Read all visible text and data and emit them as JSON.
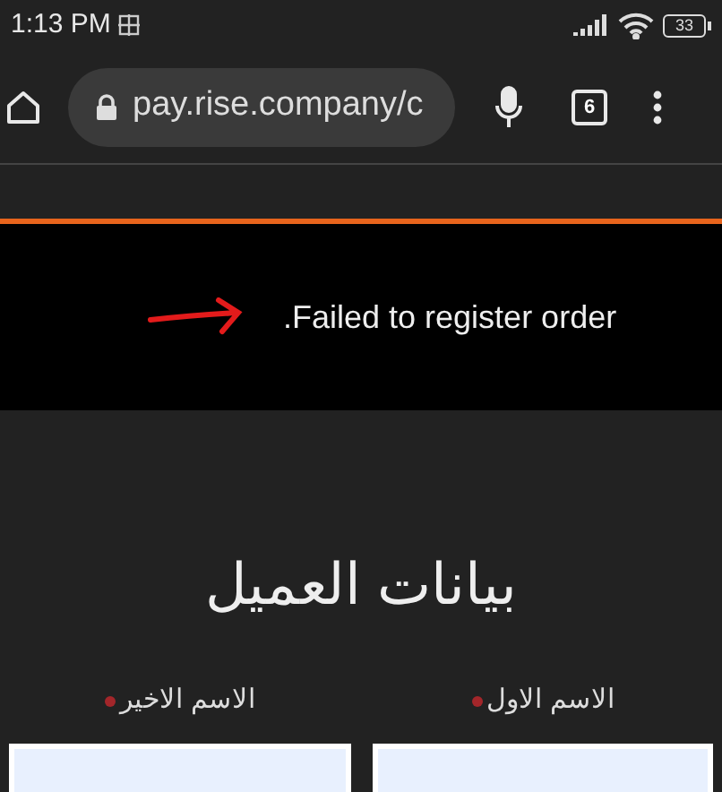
{
  "status_bar": {
    "time": "1:13 PM",
    "battery": "33"
  },
  "browser": {
    "url": "pay.rise.company/c",
    "tab_count": "6"
  },
  "alert": {
    "message": ".Failed to register order"
  },
  "form": {
    "title": "بيانات العميل",
    "fields": [
      {
        "label": "الاسم الاول",
        "required": true
      },
      {
        "label": "الاسم الاخير",
        "required": true
      }
    ]
  }
}
